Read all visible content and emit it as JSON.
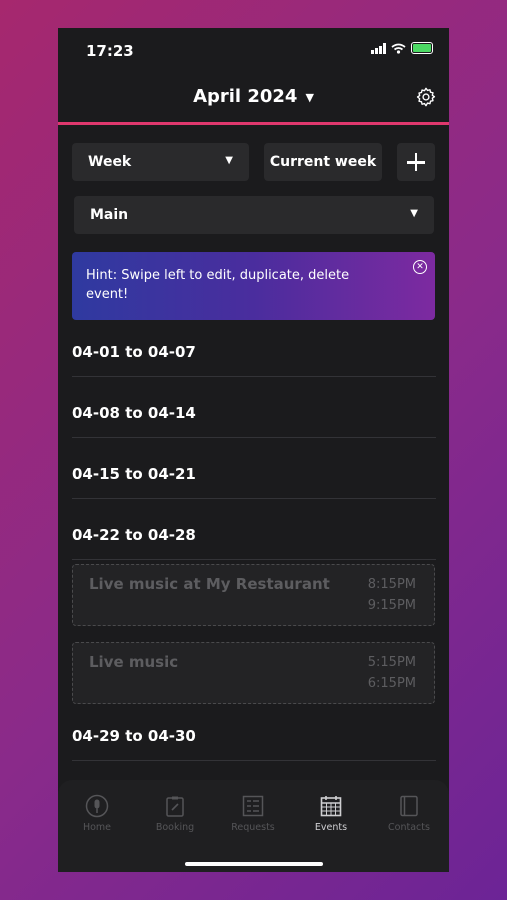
{
  "status": {
    "time": "17:23"
  },
  "header": {
    "title": "April 2024"
  },
  "controls": {
    "view_select": "Week",
    "current_week": "Current week",
    "calendar_select": "Main"
  },
  "hint": {
    "text": "Hint: Swipe left to edit, duplicate, delete event!"
  },
  "weeks": [
    {
      "range": "04-01 to 04-07"
    },
    {
      "range": "04-08 to 04-14"
    },
    {
      "range": "04-15 to 04-21"
    },
    {
      "range": "04-22 to 04-28"
    },
    {
      "range": "04-29 to 04-30"
    }
  ],
  "events": [
    {
      "title": "Live music at My Restaurant",
      "start": "8:15PM",
      "end": "9:15PM"
    },
    {
      "title": "Live music",
      "start": "5:15PM",
      "end": "6:15PM"
    }
  ],
  "tabs": [
    {
      "label": "Home",
      "icon": "microphone-icon"
    },
    {
      "label": "Booking",
      "icon": "clipboard-icon"
    },
    {
      "label": "Requests",
      "icon": "list-icon"
    },
    {
      "label": "Events",
      "icon": "calendar-icon"
    },
    {
      "label": "Contacts",
      "icon": "contacts-book-icon"
    }
  ],
  "colors": {
    "accent": "#e0386e",
    "background": "#1b1b1d",
    "hint_gradient_start": "#2f3aa0",
    "hint_gradient_end": "#7d2aa0"
  }
}
